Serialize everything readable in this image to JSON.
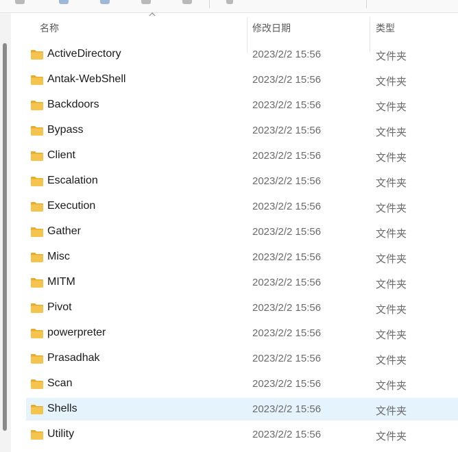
{
  "columns": {
    "name": "名称",
    "modified": "修改日期",
    "type": "类型"
  },
  "files": [
    {
      "name": "ActiveDirectory",
      "modified": "2023/2/2 15:56",
      "type": "文件夹"
    },
    {
      "name": "Antak-WebShell",
      "modified": "2023/2/2 15:56",
      "type": "文件夹"
    },
    {
      "name": "Backdoors",
      "modified": "2023/2/2 15:56",
      "type": "文件夹"
    },
    {
      "name": "Bypass",
      "modified": "2023/2/2 15:56",
      "type": "文件夹"
    },
    {
      "name": "Client",
      "modified": "2023/2/2 15:56",
      "type": "文件夹"
    },
    {
      "name": "Escalation",
      "modified": "2023/2/2 15:56",
      "type": "文件夹"
    },
    {
      "name": "Execution",
      "modified": "2023/2/2 15:56",
      "type": "文件夹"
    },
    {
      "name": "Gather",
      "modified": "2023/2/2 15:56",
      "type": "文件夹"
    },
    {
      "name": "Misc",
      "modified": "2023/2/2 15:56",
      "type": "文件夹"
    },
    {
      "name": "MITM",
      "modified": "2023/2/2 15:56",
      "type": "文件夹"
    },
    {
      "name": "Pivot",
      "modified": "2023/2/2 15:56",
      "type": "文件夹"
    },
    {
      "name": "powerpreter",
      "modified": "2023/2/2 15:56",
      "type": "文件夹"
    },
    {
      "name": "Prasadhak",
      "modified": "2023/2/2 15:56",
      "type": "文件夹"
    },
    {
      "name": "Scan",
      "modified": "2023/2/2 15:56",
      "type": "文件夹"
    },
    {
      "name": "Shells",
      "modified": "2023/2/2 15:56",
      "type": "文件夹",
      "selected": true
    },
    {
      "name": "Utility",
      "modified": "2023/2/2 15:56",
      "type": "文件夹"
    }
  ],
  "colors": {
    "selection": "#e5f3fd",
    "folder": "#f4c44e",
    "folder_dark": "#e8ac2a"
  },
  "icons": {
    "folder": "folder-icon",
    "sort": "sort-ascending-icon"
  }
}
